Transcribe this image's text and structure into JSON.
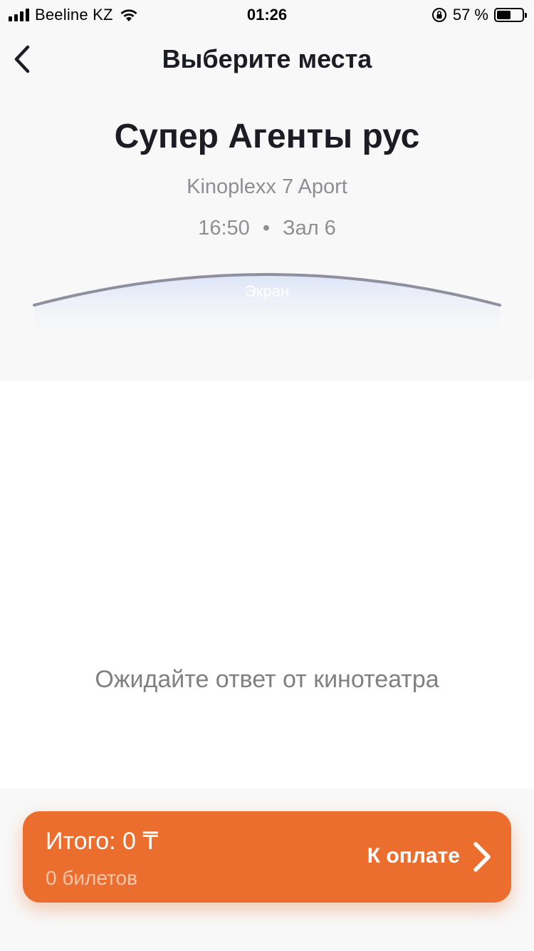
{
  "status_bar": {
    "carrier": "Beeline KZ",
    "time": "01:26",
    "battery_percent": "57 %",
    "battery_level": 0.57
  },
  "nav": {
    "title": "Выберите места"
  },
  "movie": {
    "title": "Супер Агенты рус",
    "cinema": "Kinoplexx 7 Aport",
    "time": "16:50",
    "separator": "•",
    "hall": "Зал 6"
  },
  "screen": {
    "label": "Экран"
  },
  "seat_map": {
    "waiting_text": "Ожидайте ответ от кинотеатра"
  },
  "checkout": {
    "total_label": "Итого: 0 ₸",
    "tickets_label": "0 билетов",
    "pay_label": "К оплате"
  },
  "colors": {
    "accent": "#ec6e2f",
    "background_top": "#f8f8f8",
    "text_primary": "#1c1c24",
    "text_secondary": "#8e8e93"
  }
}
